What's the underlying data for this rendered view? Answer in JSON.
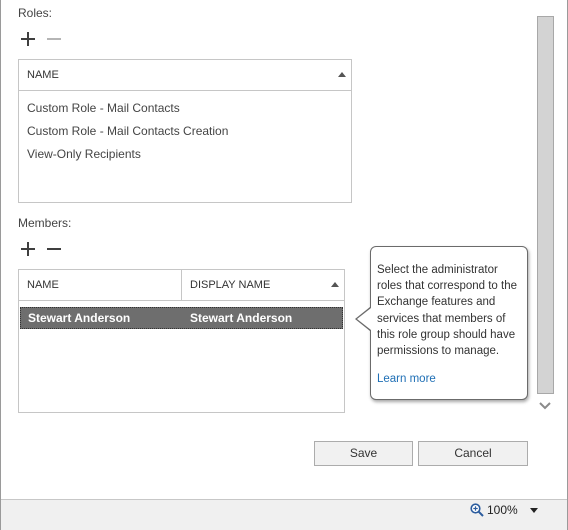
{
  "roles": {
    "label": "Roles:",
    "column": "NAME",
    "items": [
      "Custom Role - Mail Contacts",
      "Custom Role - Mail Contacts Creation",
      "View-Only Recipients"
    ]
  },
  "members": {
    "label": "Members:",
    "columns": [
      "NAME",
      "DISPLAY NAME"
    ],
    "rows": [
      {
        "name": "Stewart Anderson",
        "display_name": "Stewart Anderson"
      }
    ]
  },
  "help": {
    "text": "Select the administrator roles that correspond to the Exchange features and services that members of this role group should have permissions to manage.",
    "link": "Learn more"
  },
  "buttons": {
    "save": "Save",
    "cancel": "Cancel"
  },
  "status": {
    "zoom": "100%",
    "zoom_icon": "magnifier-plus-icon"
  },
  "colors": {
    "selected_row": "#6e6e6e",
    "link": "#1f6fb5"
  }
}
